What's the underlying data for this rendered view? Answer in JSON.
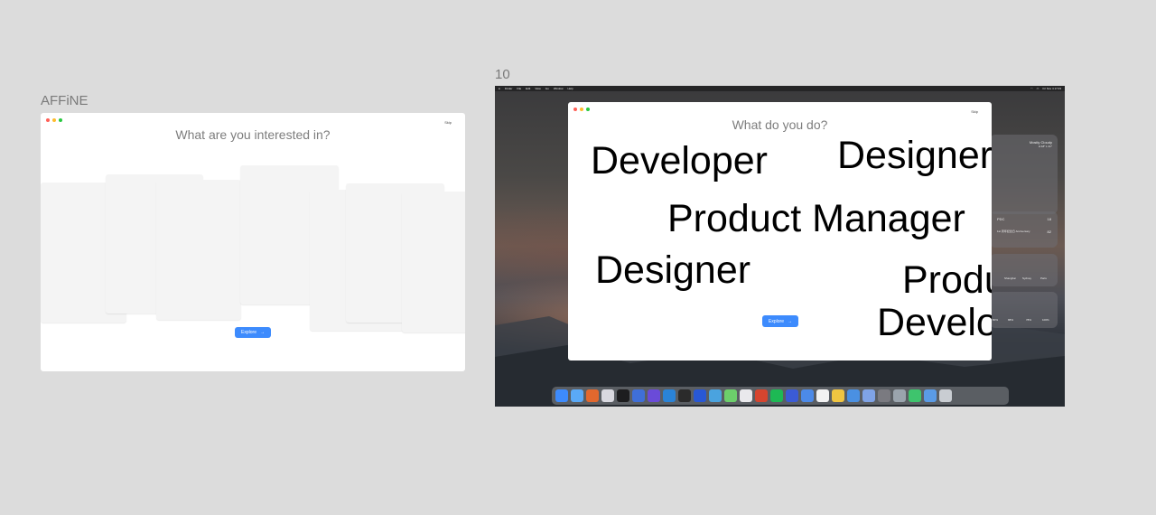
{
  "frame1": {
    "label": "AFFiNE",
    "skip_label": "Skip",
    "title": "What are you interested in?",
    "explore_label": "Explore",
    "explore_arrow": "→"
  },
  "frame2": {
    "label": "10",
    "menubar": {
      "items": [
        "Finder",
        "File",
        "Edit",
        "View",
        "Go",
        "Window",
        "Help"
      ],
      "time": "Fri Nov 4 17:03"
    },
    "window": {
      "skip_label": "Skip",
      "title": "What do you do?",
      "roles": [
        "Developer",
        "Designer",
        "Product Manager",
        "Designer",
        "Product Manager",
        "Developer"
      ],
      "explore_label": "Explore",
      "explore_arrow": "→"
    },
    "weather": {
      "place": "Mostly Cloudy",
      "range": "H:18° L:11°"
    },
    "stocks": {
      "ticker": "PDC",
      "value": "18",
      "event_title": "1st 周年纪念日 Anniversary",
      "event_value": "82"
    },
    "clocks": [
      "Shanghai",
      "Sydney",
      "Paris"
    ],
    "battery": [
      "80%",
      "88%",
      "78%",
      "100%"
    ]
  },
  "colors": {
    "accent": "#3d8bfd",
    "canvas": "#dcdcdc",
    "card": "#f4f4f4"
  }
}
